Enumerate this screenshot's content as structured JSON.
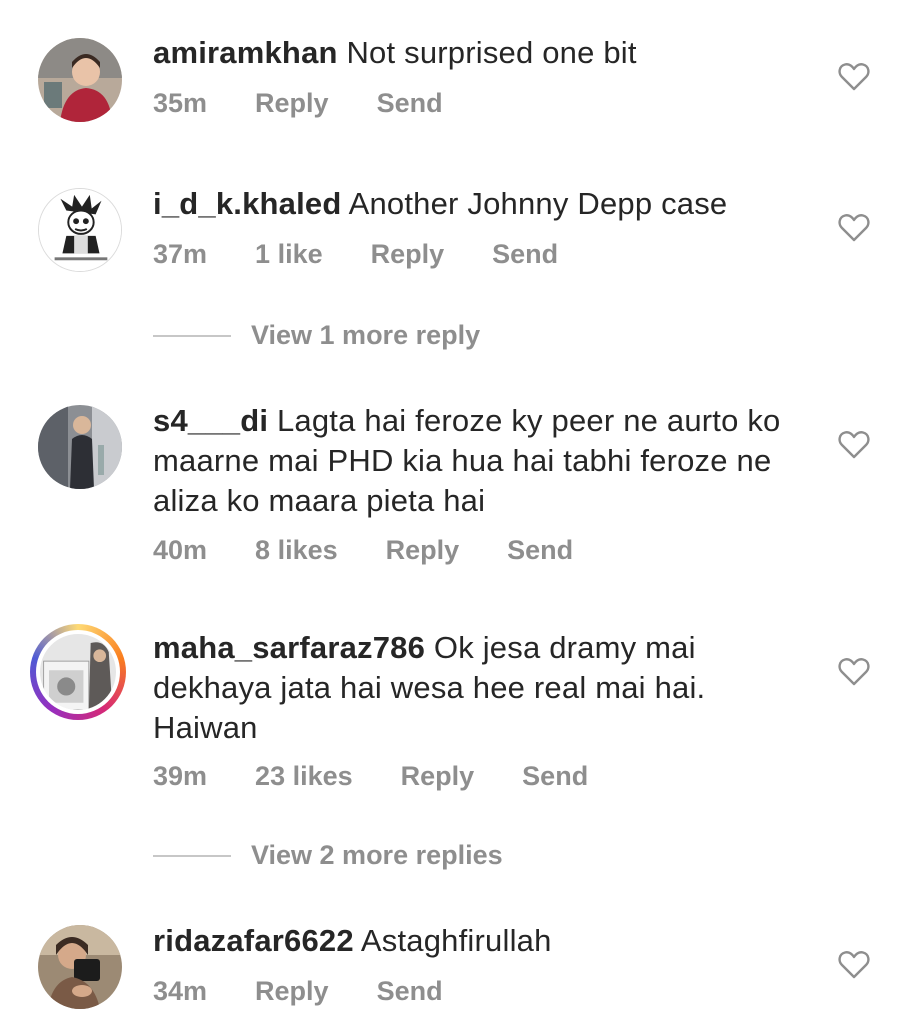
{
  "comments": [
    {
      "username": "amiramkhan",
      "text": "Not surprised one bit",
      "time": "35m",
      "likes": "",
      "reply": "Reply",
      "send": "Send",
      "avatar": "person-photo"
    },
    {
      "username": "i_d_k.khaled",
      "text": "Another Johnny Depp case",
      "time": "37m",
      "likes": "1 like",
      "reply": "Reply",
      "send": "Send",
      "avatar": "cartoon-character"
    },
    {
      "username": "s4___di",
      "text": "Lagta hai feroze ky peer ne aurto ko maarne mai PHD kia hua hai tabhi feroze ne aliza ko maara pieta hai",
      "time": "40m",
      "likes": "8 likes",
      "reply": "Reply",
      "send": "Send",
      "avatar": "person-photo"
    },
    {
      "username": "maha_sarfaraz786",
      "text": "Ok jesa dramy mai dekhaya jata hai wesa hee real mai hai. Haiwan",
      "time": "39m",
      "likes": "23 likes",
      "reply": "Reply",
      "send": "Send",
      "avatar": "person-photo-story"
    },
    {
      "username": "ridazafar6622",
      "text": "Astaghfirullah",
      "time": "34m",
      "likes": "",
      "reply": "Reply",
      "send": "Send",
      "avatar": "person-photo"
    }
  ],
  "view_more": [
    {
      "label": "View 1 more reply"
    },
    {
      "label": "View 2 more replies"
    }
  ],
  "icons": {
    "like": "heart-outline-icon"
  },
  "colors": {
    "text": "#262626",
    "meta": "#8e8e8e",
    "divider": "#c7c7c7"
  }
}
